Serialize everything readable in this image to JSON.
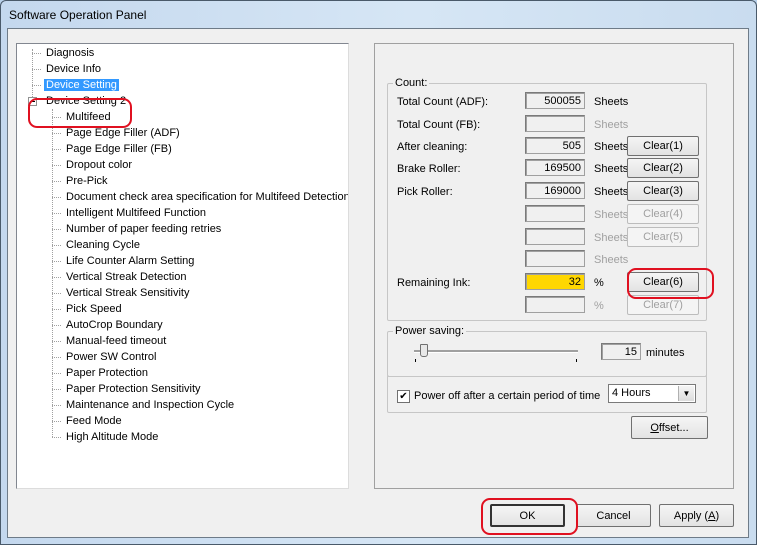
{
  "window": {
    "title": "Software Operation Panel"
  },
  "tree": {
    "items": [
      {
        "label": "Diagnosis",
        "level": 0
      },
      {
        "label": "Device Info",
        "level": 0
      },
      {
        "label": "Device Setting",
        "level": 0,
        "selected": true
      },
      {
        "label": "Device Setting 2",
        "level": 0,
        "expanded": true
      },
      {
        "label": "Multifeed",
        "level": 1
      },
      {
        "label": "Page Edge Filler (ADF)",
        "level": 1
      },
      {
        "label": "Page Edge Filler (FB)",
        "level": 1
      },
      {
        "label": "Dropout color",
        "level": 1
      },
      {
        "label": "Pre-Pick",
        "level": 1
      },
      {
        "label": "Document check area specification for Multifeed Detection",
        "level": 1
      },
      {
        "label": "Intelligent Multifeed Function",
        "level": 1
      },
      {
        "label": "Number of paper feeding retries",
        "level": 1
      },
      {
        "label": "Cleaning Cycle",
        "level": 1
      },
      {
        "label": "Life Counter Alarm Setting",
        "level": 1
      },
      {
        "label": "Vertical Streak Detection",
        "level": 1
      },
      {
        "label": "Vertical Streak Sensitivity",
        "level": 1
      },
      {
        "label": "Pick Speed",
        "level": 1
      },
      {
        "label": "AutoCrop Boundary",
        "level": 1
      },
      {
        "label": "Manual-feed timeout",
        "level": 1
      },
      {
        "label": "Power SW Control",
        "level": 1
      },
      {
        "label": "Paper Protection",
        "level": 1
      },
      {
        "label": "Paper Protection Sensitivity",
        "level": 1
      },
      {
        "label": "Maintenance and Inspection Cycle",
        "level": 1
      },
      {
        "label": "Feed Mode",
        "level": 1
      },
      {
        "label": "High Altitude Mode",
        "level": 1
      }
    ]
  },
  "count": {
    "title": "Count:",
    "rows": [
      {
        "label": "Total Count (ADF):",
        "value": "500055",
        "unit": "Sheets",
        "unit_enabled": true,
        "button": null
      },
      {
        "label": "Total Count (FB):",
        "value": "",
        "unit": "Sheets",
        "unit_enabled": false,
        "button": null
      },
      {
        "label": "After cleaning:",
        "value": "505",
        "unit": "Sheets",
        "unit_enabled": true,
        "button": "Clear(1)",
        "button_enabled": true
      },
      {
        "label": "Brake Roller:",
        "value": "169500",
        "unit": "Sheets",
        "unit_enabled": true,
        "button": "Clear(2)",
        "button_enabled": true
      },
      {
        "label": "Pick Roller:",
        "value": "169000",
        "unit": "Sheets",
        "unit_enabled": true,
        "button": "Clear(3)",
        "button_enabled": true
      },
      {
        "label": "",
        "value": "",
        "unit": "Sheets",
        "unit_enabled": false,
        "button": "Clear(4)",
        "button_enabled": false
      },
      {
        "label": "",
        "value": "",
        "unit": "Sheets",
        "unit_enabled": false,
        "button": "Clear(5)",
        "button_enabled": false
      },
      {
        "label": "",
        "value": "",
        "unit": "Sheets",
        "unit_enabled": false,
        "button": null
      },
      {
        "label": "Remaining Ink:",
        "value": "32",
        "unit": "%",
        "unit_enabled": true,
        "button": "Clear(6)",
        "button_enabled": true
      },
      {
        "label": "",
        "value": "",
        "unit": "%",
        "unit_enabled": false,
        "button": "Clear(7)",
        "button_enabled": false
      }
    ],
    "ink_color": "#ffd700"
  },
  "power_saving": {
    "title": "Power saving:",
    "minutes_value": "15",
    "minutes_unit": "minutes",
    "slider_fraction": 0.04,
    "power_off_checked": true,
    "power_off_label": "Power off after a certain period of time",
    "power_off_selected": "4 Hours"
  },
  "offset_button": {
    "prefix": "O",
    "rest": "ffset..."
  },
  "footer": {
    "ok": "OK",
    "cancel": "Cancel",
    "apply_prefix": "Apply (",
    "apply_accel": "A",
    "apply_suffix": ")"
  },
  "annotations": {
    "highlight_color": "#e01020"
  }
}
